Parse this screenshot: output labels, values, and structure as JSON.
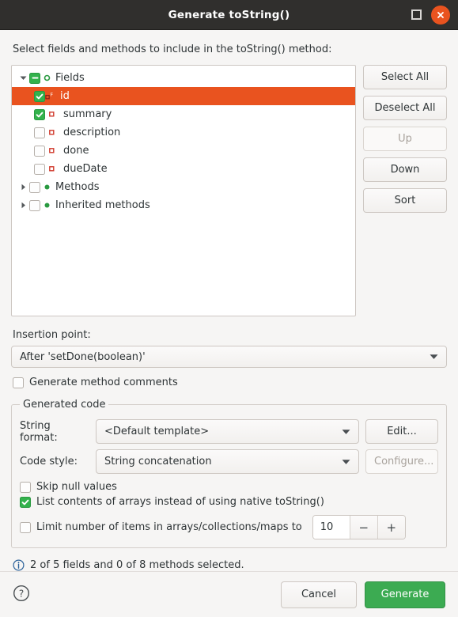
{
  "window": {
    "title": "Generate toString()",
    "maximize_icon": "maximize-icon",
    "close_icon": "close-icon"
  },
  "intro": {
    "label": "Select fields and methods to include in the toString() method:"
  },
  "tree": {
    "nodes": [
      {
        "label": "Fields",
        "level": 0,
        "state": "partial",
        "twisty": "expanded",
        "icon": "field-group-icon"
      },
      {
        "label": "id",
        "level": 1,
        "state": "checked",
        "twisty": "none",
        "icon": "field-final-icon",
        "selected": true
      },
      {
        "label": "summary",
        "level": 1,
        "state": "checked",
        "twisty": "none",
        "icon": "field-icon"
      },
      {
        "label": "description",
        "level": 1,
        "state": "unchecked",
        "twisty": "none",
        "icon": "field-icon"
      },
      {
        "label": "done",
        "level": 1,
        "state": "unchecked",
        "twisty": "none",
        "icon": "field-icon"
      },
      {
        "label": "dueDate",
        "level": 1,
        "state": "unchecked",
        "twisty": "none",
        "icon": "field-icon"
      },
      {
        "label": "Methods",
        "level": 0,
        "state": "unchecked",
        "twisty": "collapsed",
        "icon": "method-icon"
      },
      {
        "label": "Inherited methods",
        "level": 0,
        "state": "unchecked",
        "twisty": "collapsed",
        "icon": "method-icon"
      }
    ]
  },
  "side_buttons": [
    {
      "label": "Select All",
      "enabled": true
    },
    {
      "label": "Deselect All",
      "enabled": true
    },
    {
      "label": "Up",
      "enabled": false
    },
    {
      "label": "Down",
      "enabled": true
    },
    {
      "label": "Sort",
      "enabled": true
    }
  ],
  "insertion": {
    "label": "Insertion point:",
    "value": "After 'setDone(boolean)'"
  },
  "generate_comments": {
    "label": "Generate method comments",
    "checked": false
  },
  "generated_code": {
    "legend": "Generated code",
    "string_format": {
      "label": "String format:",
      "value": "<Default template>",
      "button": "Edit...",
      "button_enabled": true
    },
    "code_style": {
      "label": "Code style:",
      "value": "String concatenation",
      "button": "Configure...",
      "button_enabled": false
    },
    "options": [
      {
        "label": "Skip null values",
        "checked": false
      },
      {
        "label": "List contents of arrays instead of using native toString()",
        "checked": true
      },
      {
        "label": "Limit number of items in arrays/collections/maps to",
        "checked": false
      }
    ],
    "limit": {
      "value": "10",
      "decrement": "−",
      "increment": "+"
    }
  },
  "status": {
    "icon": "info-icon",
    "text": "2 of 5 fields and 0 of 8 methods selected."
  },
  "footer": {
    "help_icon": "help-icon",
    "cancel": "Cancel",
    "generate": "Generate"
  },
  "colors": {
    "titlebar": "#302f2d",
    "close": "#e9531f",
    "selection": "#e9531f",
    "check_green": "#33b24c",
    "primary_green": "#3cab52",
    "field_icon": "#d0392b",
    "method_icon": "#2a9a41",
    "info_blue": "#2a6099",
    "window_bg": "#f6f5f4"
  }
}
